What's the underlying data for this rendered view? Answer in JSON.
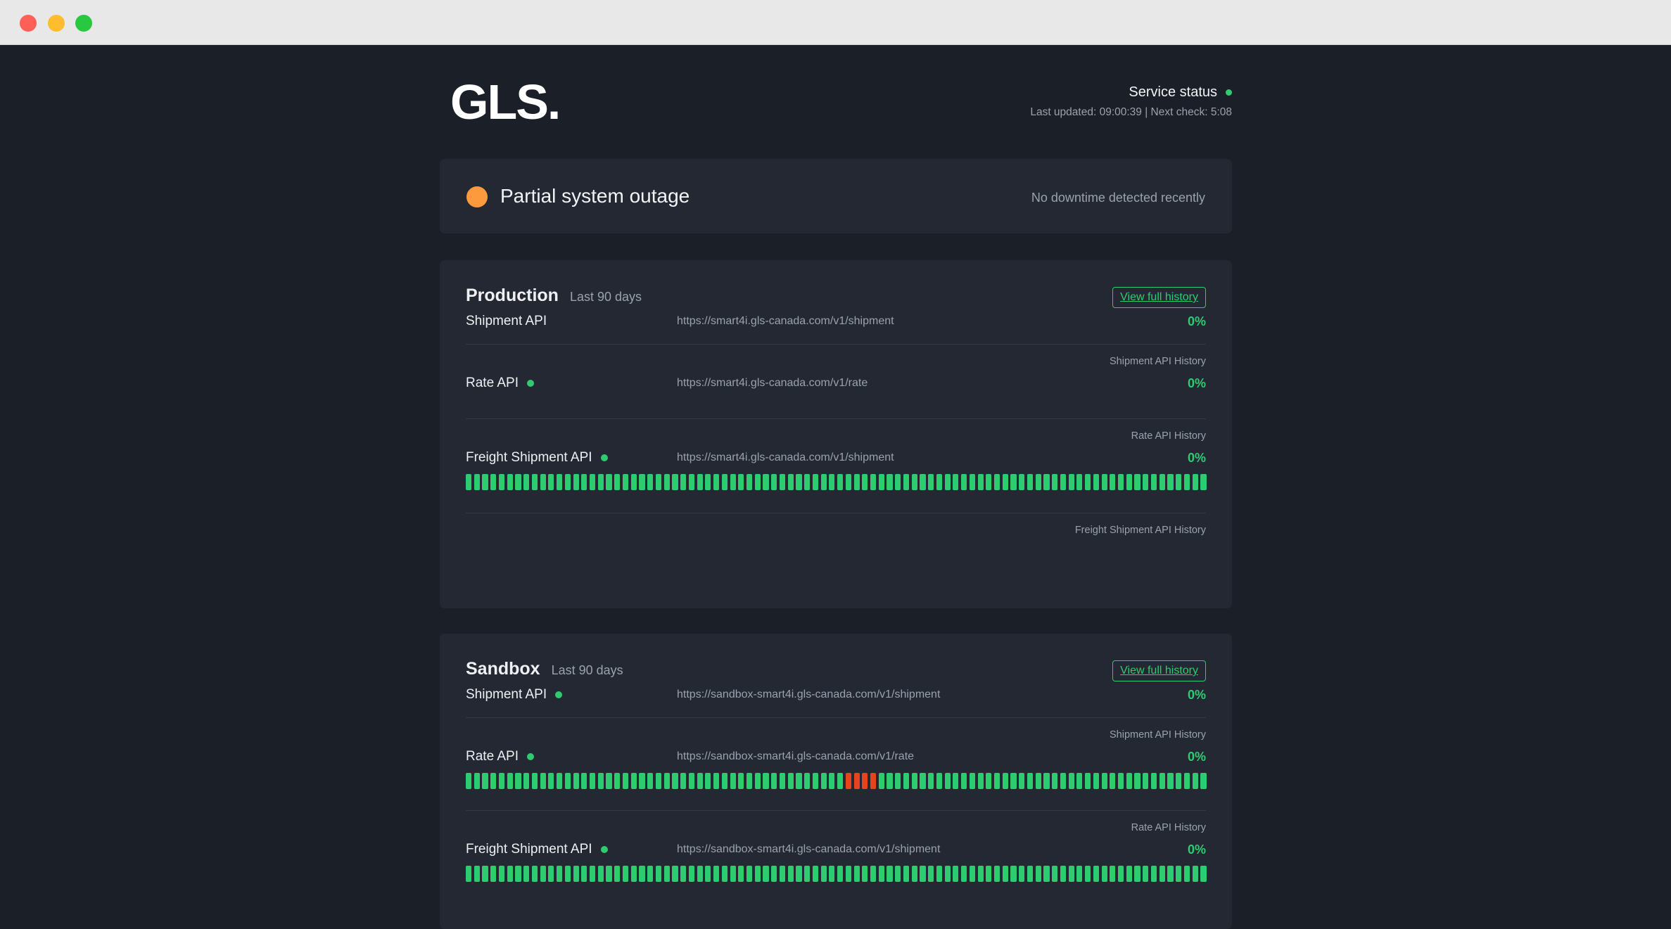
{
  "window": {
    "controls": [
      "close",
      "minimize",
      "maximize"
    ]
  },
  "header": {
    "logo": "GLS.",
    "service_status_label": "Service status",
    "meta": "Last updated: 09:00:39 | Next check: 5:08"
  },
  "banner": {
    "title": "Partial system outage",
    "note": "No downtime detected recently",
    "status_color": "#fd9a3e"
  },
  "colors": {
    "up": "#2ecc71",
    "down": "#e8431e",
    "background": "#1b1f27",
    "card": "#232833"
  },
  "sections": [
    {
      "title": "Production",
      "subtitle": "Last 90 days",
      "history_button": "View full history",
      "services": [
        {
          "name": "Shipment API",
          "url": "https://smart4i.gls-canada.com/v1/shipment",
          "percent": "0%",
          "history": "Shipment API History",
          "indicator": false,
          "bars": []
        },
        {
          "name": "Rate API",
          "url": "https://smart4i.gls-canada.com/v1/rate",
          "percent": "0%",
          "history": "Rate API History",
          "indicator": true,
          "bars": []
        },
        {
          "name": "Freight Shipment API",
          "url": "https://smart4i.gls-canada.com/v1/shipment",
          "percent": "0%",
          "history": "Freight Shipment API History",
          "indicator": true,
          "bars": "90 up"
        }
      ]
    },
    {
      "title": "Sandbox",
      "subtitle": "Last 90 days",
      "history_button": "View full history",
      "services": [
        {
          "name": "Shipment API",
          "url": "https://sandbox-smart4i.gls-canada.com/v1/shipment",
          "percent": "0%",
          "history": "Shipment API History",
          "indicator": true,
          "bars": []
        },
        {
          "name": "Rate API",
          "url": "https://sandbox-smart4i.gls-canada.com/v1/rate",
          "percent": "0%",
          "history": "Rate API History",
          "indicator": true,
          "bars": "90 days, days 47-50 down"
        },
        {
          "name": "Freight Shipment API",
          "url": "https://sandbox-smart4i.gls-canada.com/v1/shipment",
          "percent": "0%",
          "history": "",
          "indicator": true,
          "bars": "90 up"
        }
      ]
    }
  ]
}
